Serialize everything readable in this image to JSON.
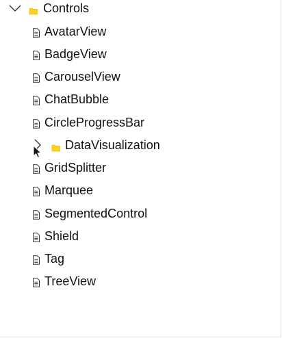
{
  "tree": {
    "root": {
      "label": "Controls",
      "expanded": true,
      "icon": "folder-open-icon"
    },
    "items": [
      {
        "label": "AvatarView",
        "icon": "document-icon"
      },
      {
        "label": "BadgeView",
        "icon": "document-icon"
      },
      {
        "label": "CarouselView",
        "icon": "document-icon"
      },
      {
        "label": "ChatBubble",
        "icon": "document-icon"
      },
      {
        "label": "CircleProgressBar",
        "icon": "document-icon"
      },
      {
        "label": "DataVisualization",
        "icon": "folder-icon",
        "expanded": false
      },
      {
        "label": "GridSplitter",
        "icon": "document-icon"
      },
      {
        "label": "Marquee",
        "icon": "document-icon"
      },
      {
        "label": "SegmentedControl",
        "icon": "document-icon"
      },
      {
        "label": "Shield",
        "icon": "document-icon"
      },
      {
        "label": "Tag",
        "icon": "document-icon"
      },
      {
        "label": "TreeView",
        "icon": "document-icon"
      }
    ]
  },
  "colors": {
    "folder": "#ffd21f",
    "text": "#111111",
    "icon_stroke": "#333333"
  }
}
